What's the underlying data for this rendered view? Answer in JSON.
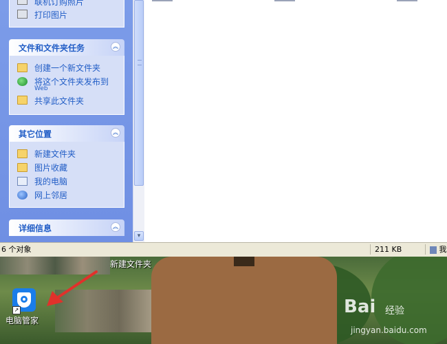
{
  "explorer": {
    "picture_tasks": {
      "items": [
        "联机订购照片",
        "打印图片"
      ]
    },
    "file_folder_tasks": {
      "title": "文件和文件夹任务",
      "items": [
        "创建一个新文件夹",
        "将这个文件夹发布到",
        "Web",
        "共享此文件夹"
      ]
    },
    "other_places": {
      "title": "其它位置",
      "items": [
        "新建文件夹",
        "图片收藏",
        "我的电脑",
        "网上邻居"
      ]
    },
    "details": {
      "title": "详细信息"
    },
    "status_bar": {
      "objects": "6 个对象",
      "size": "211 KB",
      "zone": "我"
    }
  },
  "desktop": {
    "folder_label": "新建文件夹",
    "app_label": "电脑管家",
    "watermark": {
      "brand": "Bai",
      "jingyan": "经验",
      "url": "jingyan.baidu.com"
    }
  },
  "colors": {
    "task_blue": "#215dc6",
    "arrow_red": "#e0312b"
  }
}
